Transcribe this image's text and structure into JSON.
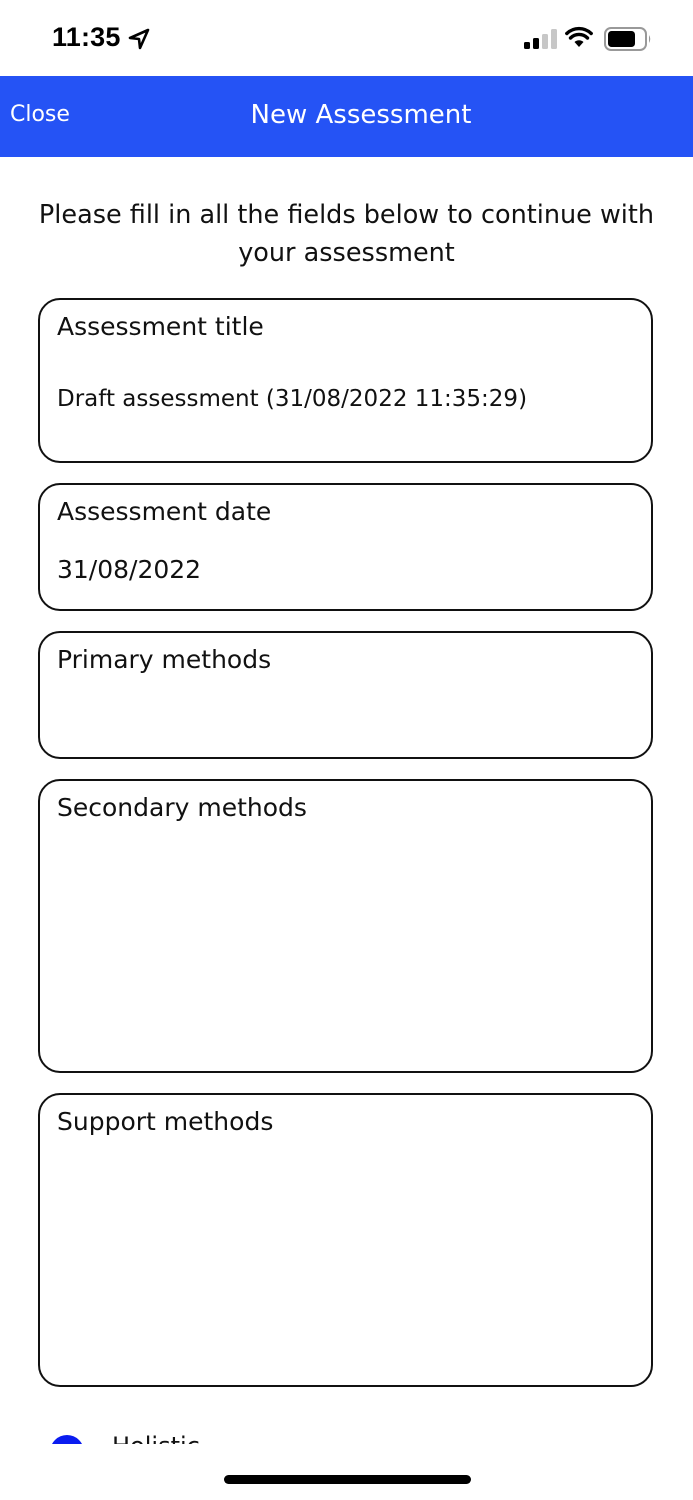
{
  "status_bar": {
    "time": "11:35",
    "icons": [
      "location-arrow-icon",
      "cellular-signal-icon",
      "wifi-icon",
      "battery-icon"
    ]
  },
  "nav": {
    "close_label": "Close",
    "title": "New Assessment",
    "background_color": "#2553f5"
  },
  "intro": {
    "text": "Please fill in all the fields below to continue with your assessment"
  },
  "fields": {
    "title": {
      "label": "Assessment title",
      "value": "Draft assessment (31/08/2022 11:35:29)"
    },
    "date": {
      "label": "Assessment date",
      "value": "31/08/2022"
    },
    "primary": {
      "label": "Primary methods",
      "value": ""
    },
    "secondary": {
      "label": "Secondary methods",
      "value": ""
    },
    "support": {
      "label": "Support methods",
      "value": ""
    }
  },
  "partial_item": {
    "label": "Holistic",
    "selected_color": "#0a1cf0"
  }
}
